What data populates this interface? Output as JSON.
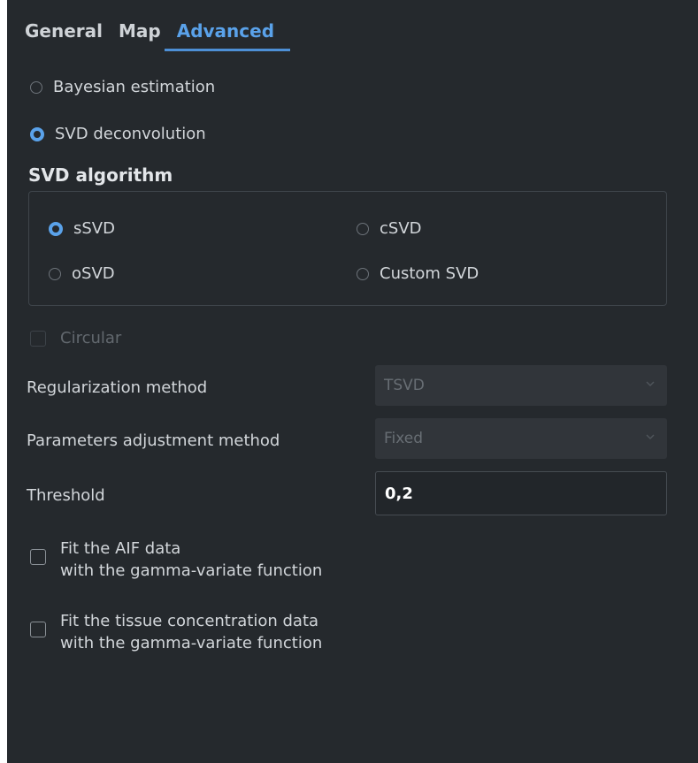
{
  "tabs": [
    {
      "label": "General"
    },
    {
      "label": "Map"
    },
    {
      "label": "Advanced",
      "active": true
    }
  ],
  "method": {
    "bayesian_label": "Bayesian estimation",
    "svd_label": "SVD deconvolution",
    "selected": "SVD deconvolution"
  },
  "svd_algorithm": {
    "title": "SVD algorithm",
    "options": [
      {
        "label": "sSVD",
        "checked": true
      },
      {
        "label": "cSVD",
        "checked": false
      },
      {
        "label": "oSVD",
        "checked": false
      },
      {
        "label": "Custom SVD",
        "checked": false
      }
    ]
  },
  "circular": {
    "label": "Circular",
    "checked": false,
    "disabled": true
  },
  "regularization": {
    "label": "Regularization method",
    "value": "TSVD"
  },
  "parameters_adjustment": {
    "label": "Parameters adjustment method",
    "value": "Fixed"
  },
  "threshold": {
    "label": "Threshold",
    "value": "0,2"
  },
  "fit_aif": {
    "line1": "Fit the AIF data",
    "line2": "with the gamma-variate function",
    "checked": false
  },
  "fit_tissue": {
    "line1": "Fit the tissue concentration data",
    "line2": "with the gamma-variate function",
    "checked": false
  },
  "colors": {
    "background": "#25292d",
    "accent": "#5aa2ea",
    "text": "#d2d6da",
    "disabled_text": "#686e74"
  }
}
